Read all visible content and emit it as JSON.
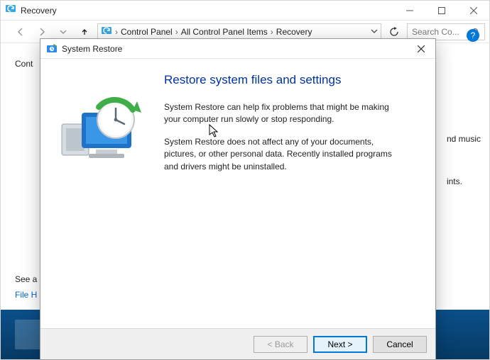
{
  "parent_window": {
    "title": "Recovery",
    "breadcrumb": [
      "Control Panel",
      "All Control Panel Items",
      "Recovery"
    ],
    "search_placeholder": "Search Co...",
    "body_left_text": "Cont",
    "see_also": "See a",
    "file_history": "File H",
    "help_tooltip": "?",
    "bg_right_lines": [
      "nd music",
      "ints."
    ]
  },
  "dialog": {
    "title": "System Restore",
    "heading": "Restore system files and settings",
    "para1": "System Restore can help fix problems that might be making your computer run slowly or stop responding.",
    "para2": "System Restore does not affect any of your documents, pictures, or other personal data. Recently installed programs and drivers might be uninstalled.",
    "buttons": {
      "back": "< Back",
      "next": "Next >",
      "cancel": "Cancel"
    }
  }
}
